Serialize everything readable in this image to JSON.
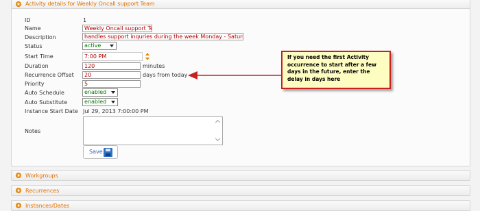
{
  "details_panel": {
    "title": "Activity details for Weekly Oncall support Team",
    "fields": {
      "id_label": "ID",
      "id_value": "1",
      "name_label": "Name",
      "name_value": "Weekly Oncall support Tea",
      "description_label": "Description",
      "description_value": "handles support inquries during the week Monday - Saturday",
      "status_label": "Status",
      "status_value": "active",
      "start_time_label": "Start Time",
      "start_time_value": "7:00 PM",
      "duration_label": "Duration",
      "duration_value": "120",
      "duration_unit": "minutes",
      "recurrence_offset_label": "Recurrence Offset",
      "recurrence_offset_value": "20",
      "recurrence_offset_unit": "days from today",
      "priority_label": "Priority",
      "priority_value": "5",
      "auto_schedule_label": "Auto Schedule",
      "auto_schedule_value": "enabled",
      "auto_substitute_label": "Auto Substitute",
      "auto_substitute_value": "enabled",
      "instance_start_label": "Instance Start Date",
      "instance_start_value": "Jul 29, 2013 7:00:00 PM",
      "notes_label": "Notes",
      "notes_value": ""
    },
    "save_label": "Save"
  },
  "callout": {
    "text": "If you need the first Activity occurrence to start after a few days in the future, enter the delay in days here"
  },
  "sections": {
    "workgroups": "Workgroups",
    "recurrences": "Recurrences",
    "instances": "Instances/Dates"
  },
  "colors": {
    "header_text": "#e07100",
    "input_text": "#b00000",
    "select_text": "#007a00",
    "callout_border": "#c62020",
    "callout_bg": "#fdfdc2"
  },
  "icons": {
    "header_toggle": "circle-chevron-icon",
    "save": "floppy-disk-icon"
  }
}
